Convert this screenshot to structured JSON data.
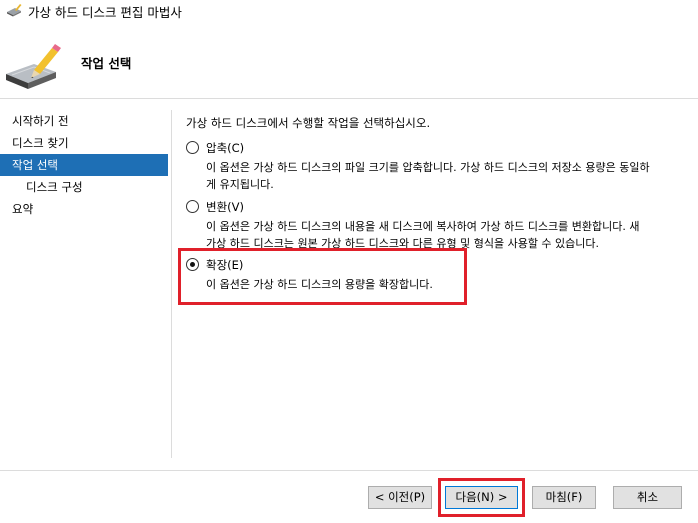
{
  "window": {
    "title": "가상 하드 디스크 편집 마법사"
  },
  "header": {
    "title": "작업 선택"
  },
  "nav": {
    "items": [
      {
        "label": "시작하기 전"
      },
      {
        "label": "디스크 찾기"
      },
      {
        "label": "작업 선택"
      },
      {
        "label": "디스크 구성"
      },
      {
        "label": "요약"
      }
    ]
  },
  "main": {
    "instruction": "가상 하드 디스크에서 수행할 작업을 선택하십시오.",
    "options": [
      {
        "label": "압축(C)",
        "desc_line1": "이 옵션은 가상 하드 디스크의 파일 크기를 압축합니다. 가상 하드 디스크의 저장소 용량은 동일하",
        "desc_line2": "게 유지됩니다.",
        "selected": false
      },
      {
        "label": "변환(V)",
        "desc_line1": "이 옵션은 가상 하드 디스크의 내용을 새 디스크에 복사하여 가상 하드 디스크를 변환합니다. 새",
        "desc_line2": "가상 하드 디스크는 원본 가상 하드 디스크와 다른 유형 및 형식을 사용할 수 있습니다.",
        "selected": false
      },
      {
        "label": "확장(E)",
        "desc_line1": "이 옵션은 가상 하드 디스크의 용량을 확장합니다.",
        "selected": true
      }
    ]
  },
  "footer": {
    "prev_label": "< 이전(P)",
    "next_label": "다음(N) >",
    "finish_label": "마침(F)",
    "cancel_label": "취소"
  },
  "colors": {
    "accent": "#1e6fb5",
    "highlight": "#e0202a"
  }
}
